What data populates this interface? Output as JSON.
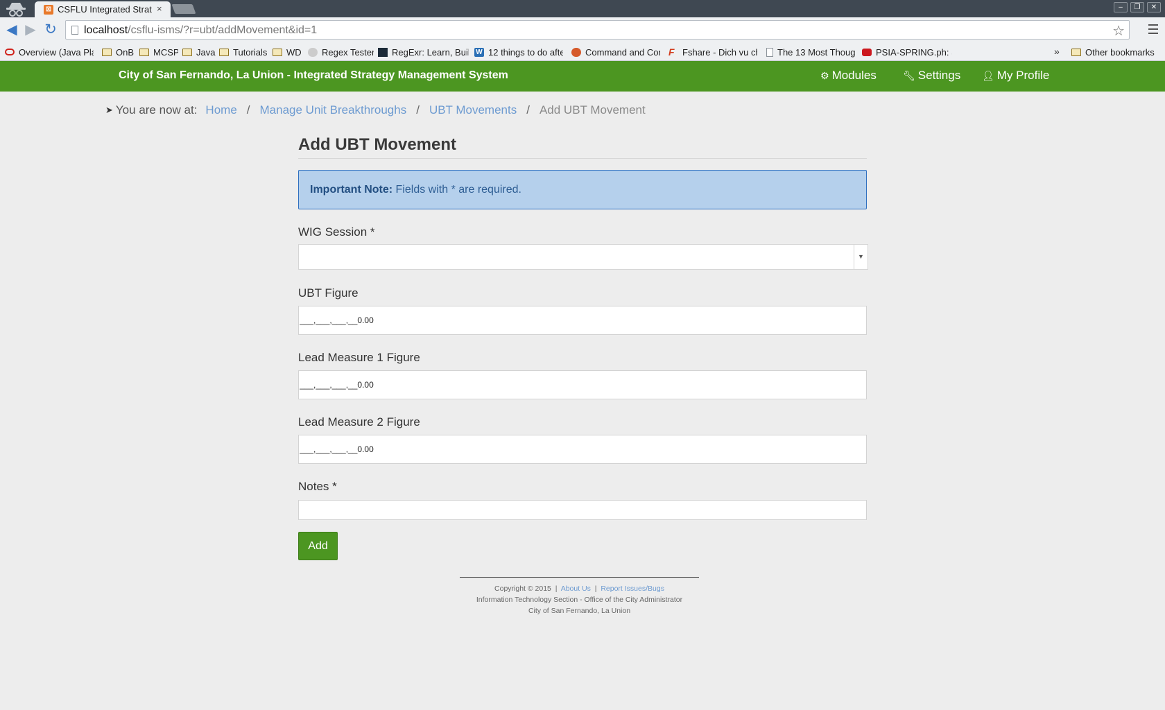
{
  "browser": {
    "tab_title": "CSFLU Integrated Strat",
    "tab_close": "×",
    "url_host": "localhost",
    "url_path": "/csflu-isms/?r=ubt/addMovement&id=1",
    "window_buttons": [
      "–",
      "❐",
      "✕"
    ],
    "bookmarks": [
      {
        "label": "Overview (Java Platf",
        "icon": "oracle-icon"
      },
      {
        "label": "OnB",
        "icon": "folder-icon"
      },
      {
        "label": "MCSP",
        "icon": "folder-icon"
      },
      {
        "label": "Java",
        "icon": "folder-icon"
      },
      {
        "label": "Tutorials",
        "icon": "folder-icon"
      },
      {
        "label": "WD",
        "icon": "folder-icon"
      },
      {
        "label": "Regex Tester",
        "icon": "regex-icon"
      },
      {
        "label": "RegExr: Learn, Build",
        "icon": "regexr-icon"
      },
      {
        "label": "12 things to do afte",
        "icon": "wordpress-icon"
      },
      {
        "label": "Command and Con",
        "icon": "firefox-icon"
      },
      {
        "label": "Fshare - Dich vu ch",
        "icon": "fshare-icon"
      },
      {
        "label": "The 13 Most Thoug",
        "icon": "page-icon"
      },
      {
        "label": "PSIA-SPRING.ph: Sc",
        "icon": "youtube-icon"
      }
    ],
    "more_bookmarks": "»",
    "other_bookmarks": "Other bookmarks"
  },
  "navbar": {
    "brand": "City of San Fernando, La Union - Integrated Strategy Management System",
    "links": [
      {
        "label": "Modules",
        "icon": "cogs-icon"
      },
      {
        "label": "Settings",
        "icon": "wrench-icon"
      },
      {
        "label": "My Profile",
        "icon": "user-icon"
      }
    ]
  },
  "breadcrumb": {
    "prefix": "You are now at:",
    "items": [
      "Home",
      "Manage Unit Breakthroughs",
      "UBT Movements"
    ],
    "current": "Add UBT Movement",
    "separator": "/"
  },
  "form": {
    "title": "Add UBT Movement",
    "note_label": "Important Note:",
    "note_text": " Fields with * are required.",
    "wig_session_label": "WIG Session *",
    "wig_session_value": "",
    "ubt_figure_label": "UBT Figure",
    "ubt_figure_value": "___,___,___,__0.00",
    "lead1_label": "Lead Measure 1 Figure",
    "lead1_value": "___,___,___,__0.00",
    "lead2_label": "Lead Measure 2 Figure",
    "lead2_value": "___,___,___,__0.00",
    "notes_label": "Notes *",
    "notes_value": "",
    "submit_label": "Add"
  },
  "footer": {
    "copyright": "Copyright © 2015",
    "about": "About Us",
    "report": "Report Issues/Bugs",
    "line2": "Information Technology Section - Office of the City Administrator",
    "line3": "City of San Fernando, La Union"
  },
  "colors": {
    "navbar": "#4c9621",
    "link": "#6d9bd1",
    "alert_bg": "#b5d0ec",
    "alert_border": "#2f70c0"
  }
}
